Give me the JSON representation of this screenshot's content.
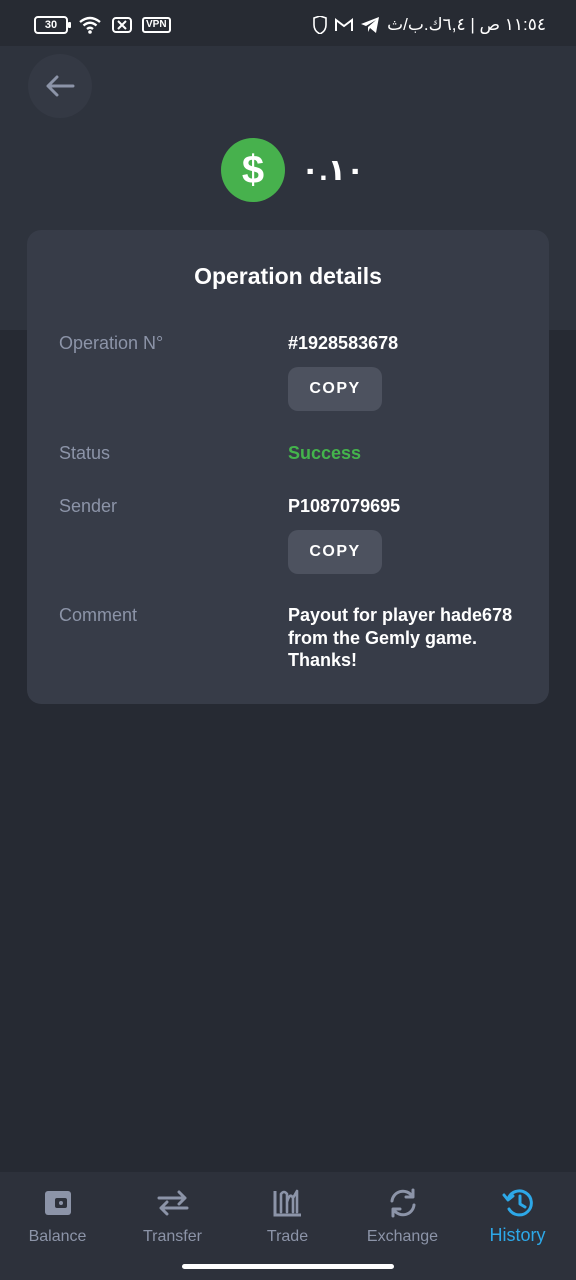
{
  "status_bar": {
    "battery": "30",
    "vpn": "VPN",
    "time_date": "١١:٥٤ ص | ٦,٤ك.ب/ث"
  },
  "header": {
    "amount": "٠.١٠",
    "currency_icon": "dollar-icon",
    "currency_color": "#47b14d"
  },
  "card": {
    "title": "Operation details",
    "operation_label": "Operation N°",
    "operation_value": "#1928583678",
    "copy_label": "COPY",
    "status_label": "Status",
    "status_value": "Success",
    "status_color": "#44b44c",
    "sender_label": "Sender",
    "sender_value": "P1087079695",
    "comment_label": "Comment",
    "comment_value": "Payout for player hade678 from the Gemly game. Thanks!"
  },
  "nav": {
    "items": [
      {
        "label": "Balance",
        "icon": "wallet-icon"
      },
      {
        "label": "Transfer",
        "icon": "transfer-icon"
      },
      {
        "label": "Trade",
        "icon": "trade-icon"
      },
      {
        "label": "Exchange",
        "icon": "exchange-icon"
      },
      {
        "label": "History",
        "icon": "history-icon",
        "active": true
      }
    ],
    "active_color": "#2da8e8"
  }
}
